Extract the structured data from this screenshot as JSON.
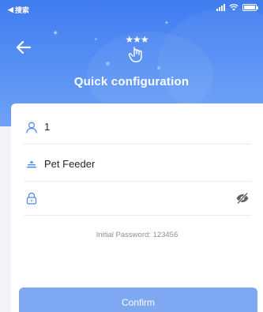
{
  "status_bar": {
    "back_label": "搜索",
    "back_glyph": "◀"
  },
  "header": {
    "title": "Quick configuration",
    "background_color": "#4a86f2",
    "logo_stars": "★★★"
  },
  "form": {
    "account_value": "1",
    "device_name_value": "Pet Feeder",
    "password_value": "",
    "password_placeholder": "",
    "hint_text": "Initial Password: 123456",
    "accent_color": "#4a86f2"
  },
  "confirm_button": {
    "label": "Confirm",
    "color": "#7ea9f2"
  }
}
